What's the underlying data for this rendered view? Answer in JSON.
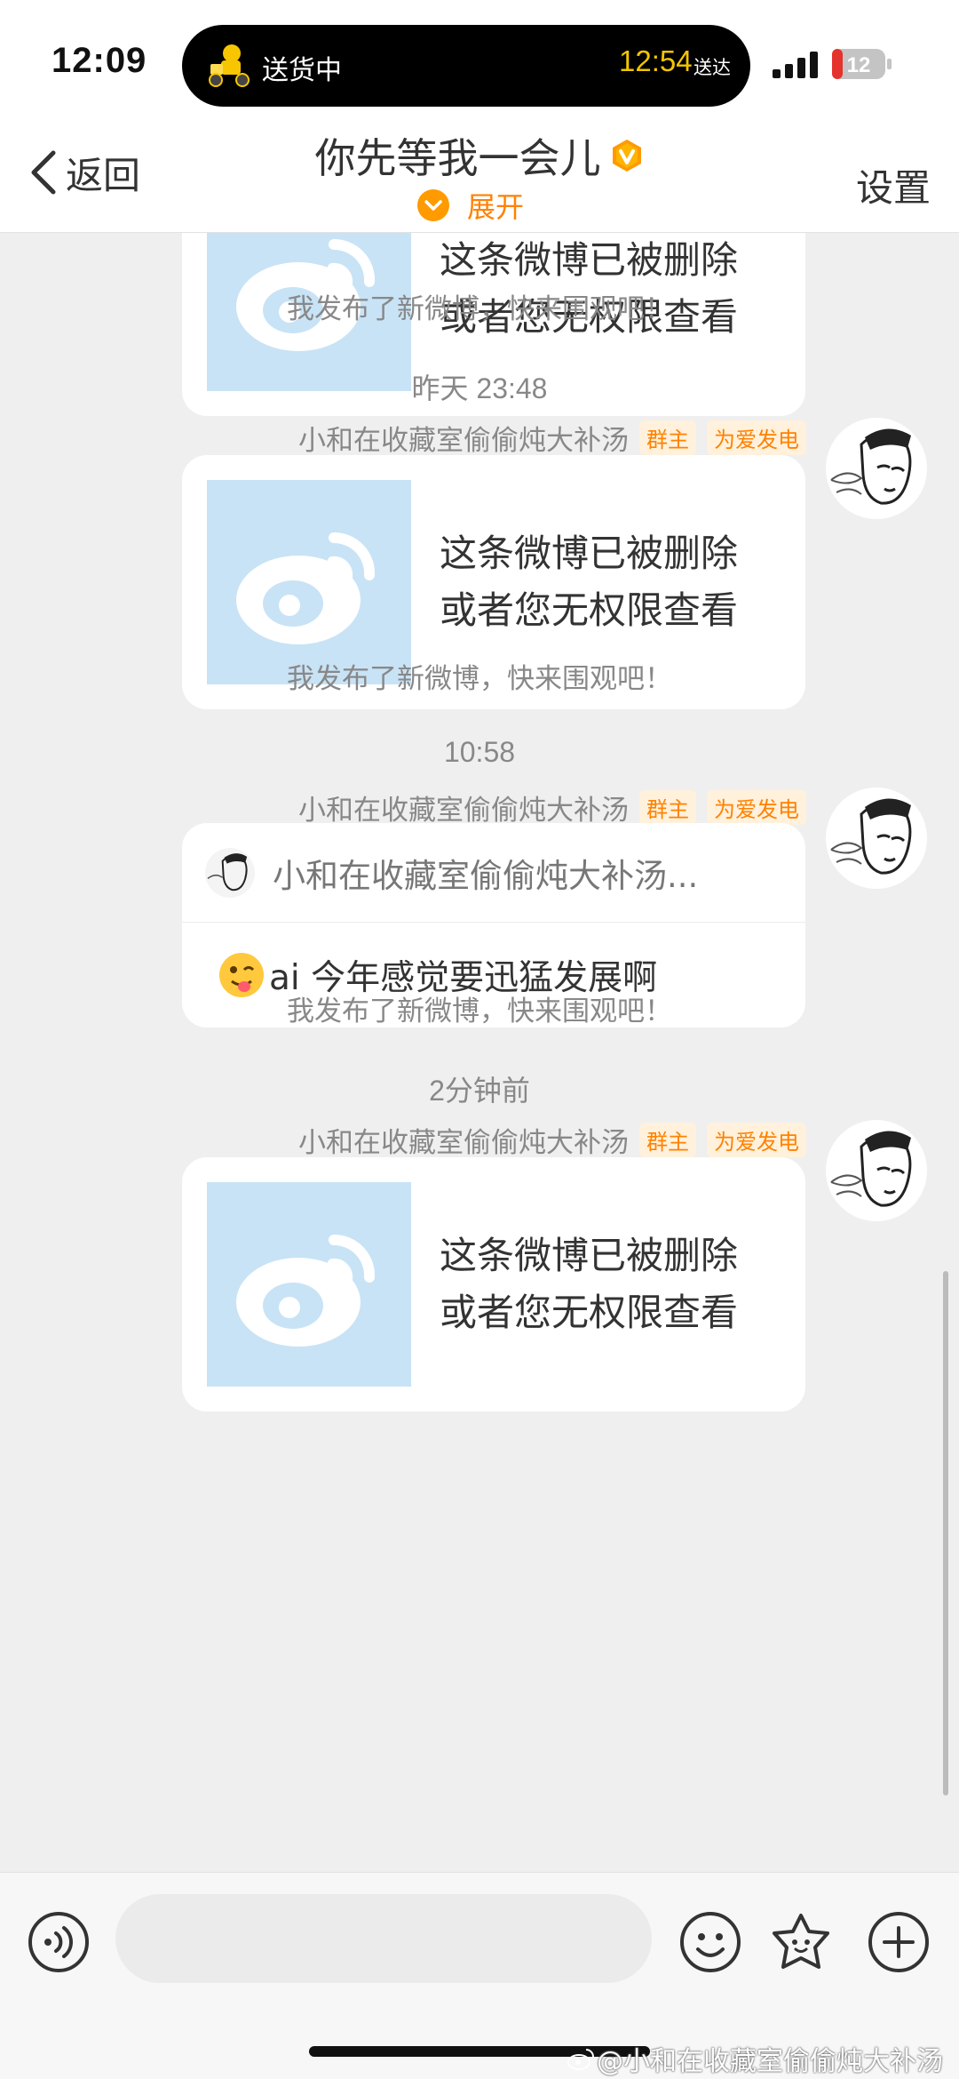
{
  "status_bar": {
    "time": "12:09",
    "delivery_label": "送货中",
    "eta_time": "12:54",
    "eta_suffix": "送达",
    "battery": "12"
  },
  "header": {
    "back_label": "返回",
    "title": "你先等我一会儿",
    "expand_label": "展开",
    "settings_label": "设置"
  },
  "messages": {
    "card_text_line1": "这条微博已被删除",
    "card_text_line2": "或者您无权限查看",
    "system_text": "我发布了新微博，快来围观吧！",
    "sender_name": "小和在收藏室偷偷炖大补汤",
    "tag_admin": "群主",
    "tag_fan": "为爱发电",
    "timestamps": [
      "昨天 23:48",
      "10:58",
      "2分钟前"
    ],
    "quote_author": "小和在收藏室偷偷炖大补汤...",
    "quote_text": "ai 今年感觉要迅猛发展啊"
  },
  "watermark": "@小和在收藏室偷偷炖大补汤",
  "colors": {
    "accent": "#ff8200",
    "placeholder_blue": "#c8e3f6",
    "background": "#efefef"
  },
  "icons": [
    "rider-icon",
    "signal-icon",
    "battery-icon",
    "back-chevron-icon",
    "verified-badge-icon",
    "expand-chevron-icon",
    "weibo-logo-icon",
    "avatar-sketch",
    "tongue-emoji-icon",
    "voice-icon",
    "smile-icon",
    "sticker-icon",
    "plus-icon",
    "weibo-watermark-icon"
  ]
}
